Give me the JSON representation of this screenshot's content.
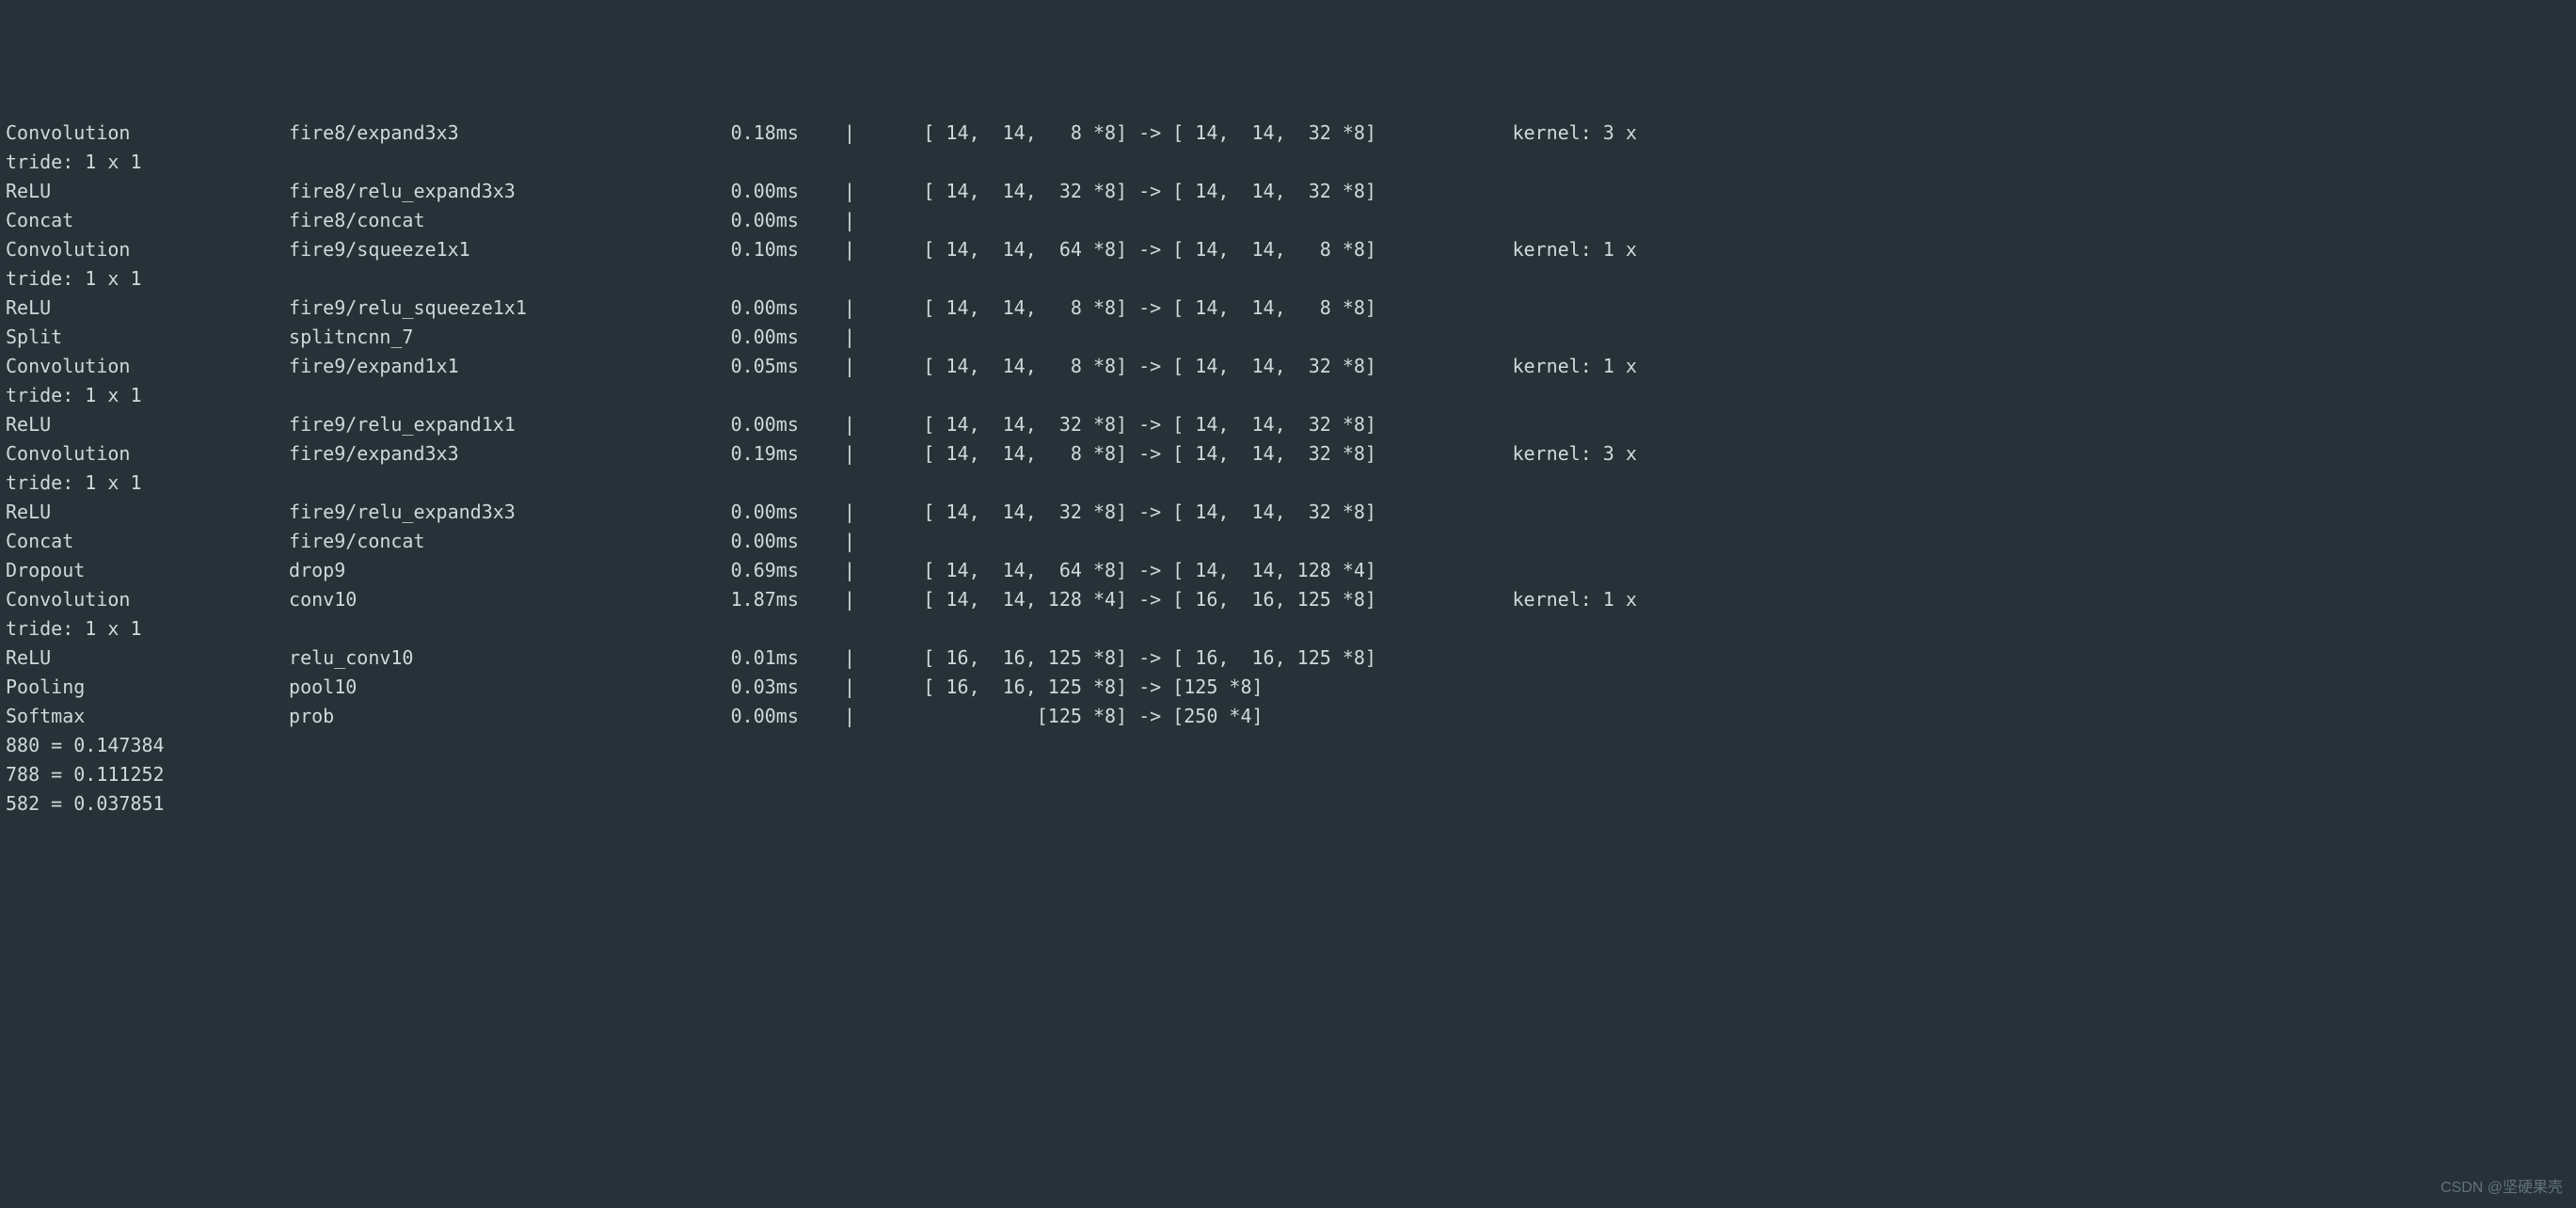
{
  "lines": [
    "Convolution              fire8/expand3x3                        0.18ms    |      [ 14,  14,   8 *8] -> [ 14,  14,  32 *8]            kernel: 3 x ",
    "tride: 1 x 1",
    "ReLU                     fire8/relu_expand3x3                   0.00ms    |      [ 14,  14,  32 *8] -> [ 14,  14,  32 *8]",
    "Concat                   fire8/concat                           0.00ms    |",
    "Convolution              fire9/squeeze1x1                       0.10ms    |      [ 14,  14,  64 *8] -> [ 14,  14,   8 *8]            kernel: 1 x ",
    "tride: 1 x 1",
    "ReLU                     fire9/relu_squeeze1x1                  0.00ms    |      [ 14,  14,   8 *8] -> [ 14,  14,   8 *8]",
    "Split                    splitncnn_7                            0.00ms    |",
    "Convolution              fire9/expand1x1                        0.05ms    |      [ 14,  14,   8 *8] -> [ 14,  14,  32 *8]            kernel: 1 x ",
    "tride: 1 x 1",
    "ReLU                     fire9/relu_expand1x1                   0.00ms    |      [ 14,  14,  32 *8] -> [ 14,  14,  32 *8]",
    "Convolution              fire9/expand3x3                        0.19ms    |      [ 14,  14,   8 *8] -> [ 14,  14,  32 *8]            kernel: 3 x ",
    "tride: 1 x 1",
    "ReLU                     fire9/relu_expand3x3                   0.00ms    |      [ 14,  14,  32 *8] -> [ 14,  14,  32 *8]",
    "Concat                   fire9/concat                           0.00ms    |",
    "Dropout                  drop9                                  0.69ms    |      [ 14,  14,  64 *8] -> [ 14,  14, 128 *4]",
    "Convolution              conv10                                 1.87ms    |      [ 14,  14, 128 *4] -> [ 16,  16, 125 *8]            kernel: 1 x ",
    "tride: 1 x 1",
    "ReLU                     relu_conv10                            0.01ms    |      [ 16,  16, 125 *8] -> [ 16,  16, 125 *8]",
    "Pooling                  pool10                                 0.03ms    |      [ 16,  16, 125 *8] -> [125 *8]",
    "Softmax                  prob                                   0.00ms    |                [125 *8] -> [250 *4]",
    "880 = 0.147384",
    "788 = 0.111252",
    "582 = 0.037851"
  ],
  "watermark": "CSDN @坚硬果壳"
}
